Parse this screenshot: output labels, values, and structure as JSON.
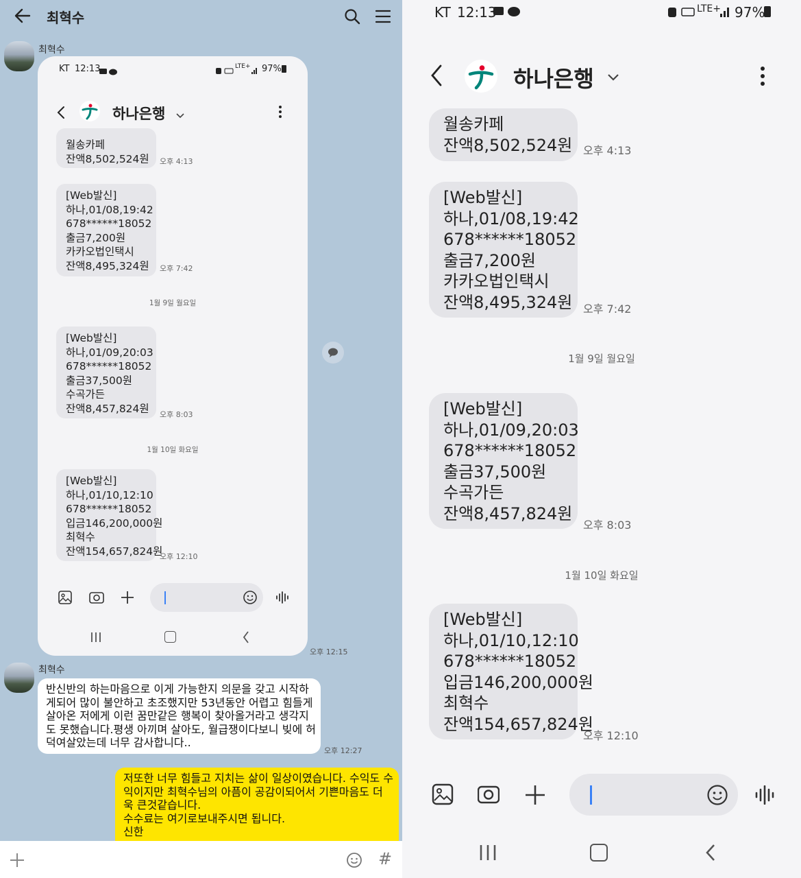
{
  "kakao": {
    "chat_title": "최혁수",
    "sender_name": "최혁수",
    "image_time": "오후 12:15",
    "received_message": "반신반의 하는마음으로 이게 가능한지 의문을 갖고 시작하\n게되어 많이 불안하고 초조했지만 53년동안 어렵고 힘들게\n살아온 저에게 이런 꿈만같은 행복이 찾아올거라고 생각지\n도 못했습니다.평생 아끼며 살아도, 월급쟁이다보니 빚에 허\n덕여살았는데 너무 감사합니다..",
    "received_time": "오후 12:27",
    "sent_message": "저또한 너무 힘들고 지치는 삶이 일상이였습니다. 수익도 수\n익이지만 최혁수님의 아픔이 공감이되어서 기쁜마음도 더\n욱 큰것같습니다.\n수수료는 여기로보내주시면 됩니다.\n신한",
    "input_hash": "#"
  },
  "screenshot": {
    "status_carrier": "KT",
    "status_time": "12:13",
    "status_battery": "97%",
    "status_network": "LTE+",
    "bank_name": "하나은행",
    "messages": [
      {
        "text": "월송카페\n잔액8,502,524원",
        "time": "오후 4:13"
      },
      {
        "text": "[Web발신]\n하나,01/08,19:42\n678******18052\n출금7,200원\n카카오법인택시\n잔액8,495,324원",
        "time": "오후 7:42"
      },
      {
        "text": "[Web발신]\n하나,01/09,20:03\n678******18052\n출금37,500원\n수곡가든\n잔액8,457,824원",
        "time": "오후 8:03"
      },
      {
        "text": "[Web발신]\n하나,01/10,12:10\n678******18052\n입금146,200,000원\n최혁수\n잔액154,657,824원",
        "time": "오후 12:10"
      }
    ],
    "date_dividers": [
      "1월 9일 월요일",
      "1월 10일 화요일"
    ]
  },
  "colors": {
    "kakao_bg": "#b2c7d9",
    "my_bubble": "#fee500",
    "sms_bubble": "#e4e4e8",
    "hana_green": "#00857a",
    "hana_red": "#e4002b"
  }
}
